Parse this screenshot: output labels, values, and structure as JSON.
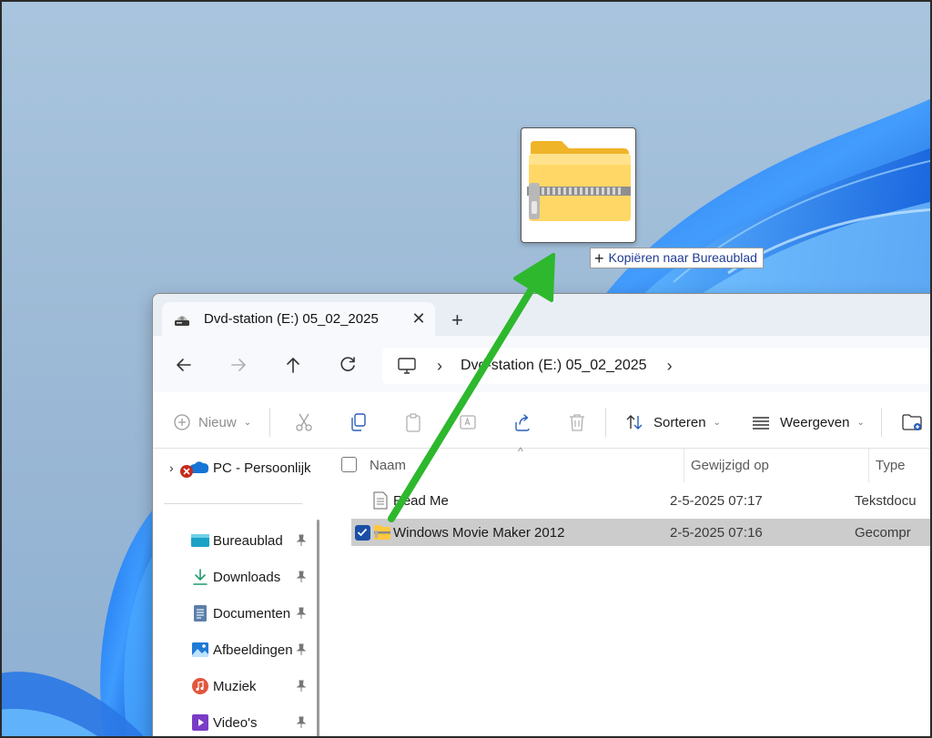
{
  "drag": {
    "tooltip_text": "Kopiëren naar Bureaublad"
  },
  "window": {
    "tab_title": "Dvd-station (E:) 05_02_2025",
    "address_crumb": "Dvd-station (E:) 05_02_2025"
  },
  "commandbar": {
    "new_label": "Nieuw",
    "sort_label": "Sorteren",
    "view_label": "Weergeven"
  },
  "sidebar": {
    "cloud_item": "PC - Persoonlijk",
    "items": [
      {
        "label": "Bureaublad",
        "icon": "desktop-icon"
      },
      {
        "label": "Downloads",
        "icon": "download-icon"
      },
      {
        "label": "Documenten",
        "icon": "documents-icon"
      },
      {
        "label": "Afbeeldingen",
        "icon": "pictures-icon"
      },
      {
        "label": "Muziek",
        "icon": "music-icon"
      },
      {
        "label": "Video's",
        "icon": "videos-icon"
      }
    ]
  },
  "columns": {
    "name": "Naam",
    "modified": "Gewijzigd op",
    "type": "Type"
  },
  "files": [
    {
      "name": "Read Me",
      "modified": "2-5-2025 07:17",
      "type": "Tekstdocu",
      "selected": false,
      "icon": "text-file-icon"
    },
    {
      "name": "Windows Movie Maker 2012",
      "modified": "2-5-2025 07:16",
      "type": "Gecompr",
      "selected": true,
      "icon": "zip-folder-icon"
    }
  ],
  "colors": {
    "arrow": "#2db82d",
    "selection": "#cccccc",
    "checkbox": "#1b4fa6"
  }
}
